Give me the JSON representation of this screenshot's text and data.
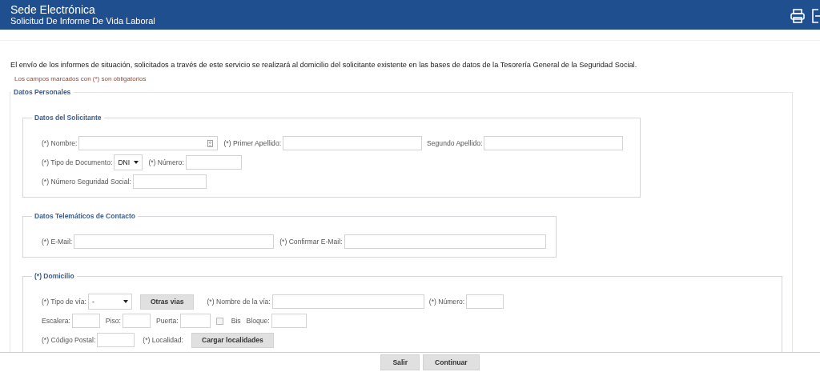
{
  "header": {
    "title": "Sede Electrónica",
    "subtitle": "Solicitud De Informe De Vida Laboral"
  },
  "notice": "El envío de los informes de situación, solicitados a través de este servicio se realizará al domicilio del solicitante existente en las bases de datos de la Tesorería General de la Seguridad Social.",
  "required_note": "Los campos marcados con (*) son obligatorios",
  "personal_data": {
    "legend": "Datos Personales",
    "sections": [
      {
        "legend": "Datos del Solicitante",
        "lines": [
          {
            "fields": [
              {
                "kind": "input_icon",
                "label": "(*) Nombre:"
              },
              {
                "kind": "input",
                "label": "(*) Primer Apellido:"
              },
              {
                "kind": "input",
                "label": "Segundo Apellido:"
              }
            ]
          },
          {
            "fields": [
              {
                "kind": "select",
                "label": "(*) Tipo de Documento:",
                "value": "DNI"
              },
              {
                "kind": "input",
                "label": "(*) Número:"
              }
            ]
          },
          {
            "fields": [
              {
                "kind": "input",
                "label": "(*) Número Seguridad Social:"
              }
            ]
          }
        ]
      },
      {
        "legend": "Datos Telemáticos de Contacto",
        "lines": [
          {
            "fields": [
              {
                "kind": "input",
                "label": "(*) E-Mail:"
              },
              {
                "kind": "input",
                "label": "(*) Confirmar E-Mail:"
              }
            ]
          }
        ]
      },
      {
        "legend": "(*) Domicilio",
        "lines": [
          {
            "fields": [
              {
                "kind": "select",
                "label": "(*) Tipo de vía:",
                "value": "-"
              },
              {
                "kind": "button",
                "label": "Otras vias"
              },
              {
                "kind": "input",
                "label": "(*) Nombre de la vía:"
              },
              {
                "kind": "input",
                "label": "(*) Número:"
              }
            ]
          },
          {
            "fields": [
              {
                "kind": "input",
                "label": "Escalera:"
              },
              {
                "kind": "input",
                "label": "Piso:"
              },
              {
                "kind": "input",
                "label": "Puerta:"
              },
              {
                "kind": "checkbox",
                "label": "Bis",
                "checked": false
              },
              {
                "kind": "input",
                "label": "Bloque:"
              }
            ]
          },
          {
            "fields": [
              {
                "kind": "input",
                "label": "(*) Código Postal:"
              },
              {
                "kind": "label",
                "label": "(*) Localidad:"
              },
              {
                "kind": "button",
                "label": "Cargar localidades"
              }
            ]
          }
        ]
      }
    ]
  },
  "footer_buttons": [
    "Salir",
    "Continuar"
  ]
}
